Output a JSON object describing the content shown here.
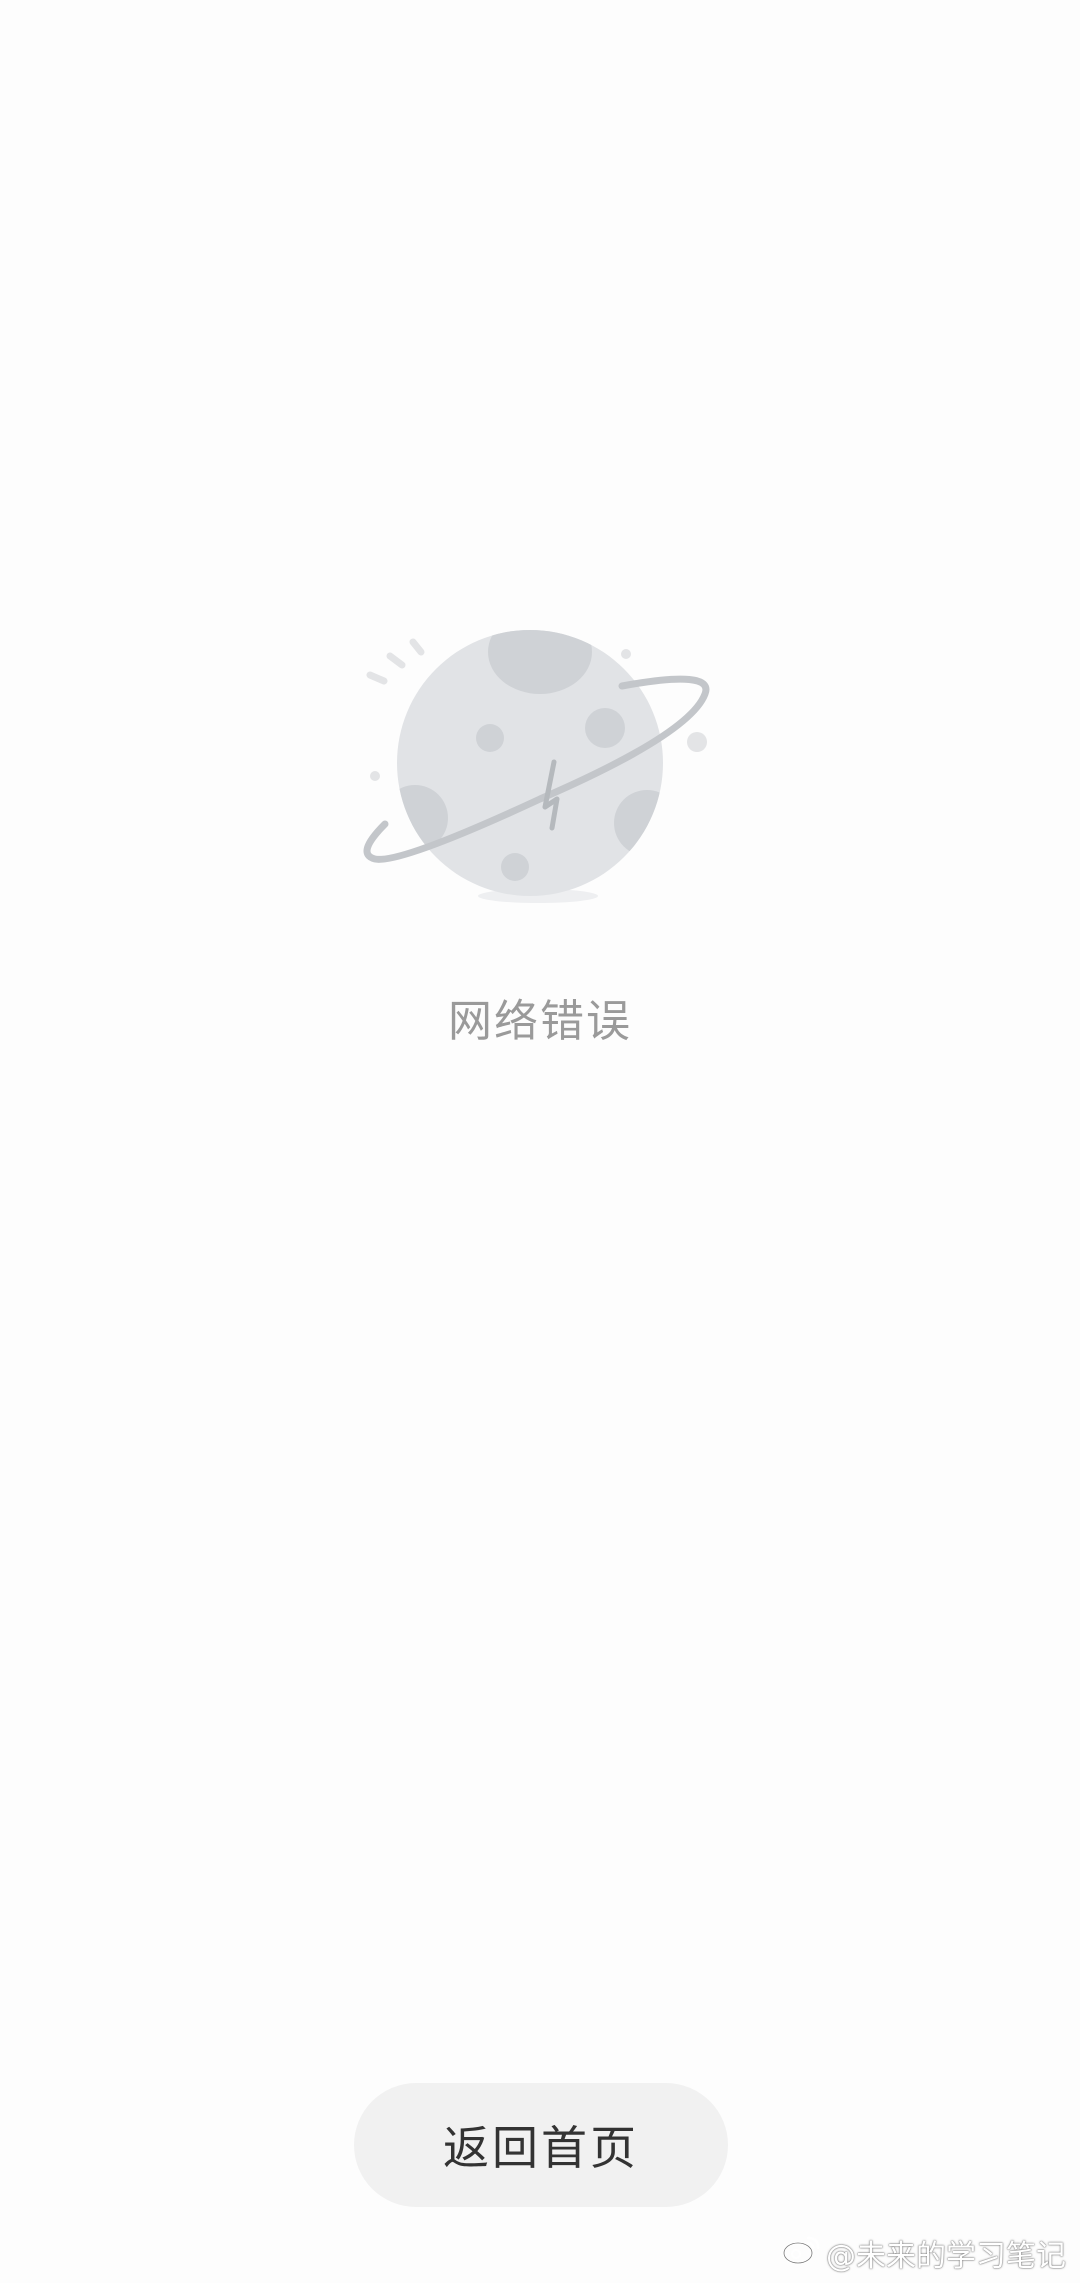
{
  "error": {
    "illustration_icon": "broken-planet-icon",
    "message": "网络错误"
  },
  "actions": {
    "home_button_label": "返回首页"
  },
  "watermark": {
    "icon": "weibo-icon",
    "text": "@未来的学习笔记"
  },
  "colors": {
    "background": "#fdfdfd",
    "planet": "#e1e3e6",
    "crater": "#cfd2d6",
    "orbit": "#c3c6ca",
    "message_text": "#9a9a9a",
    "button_background": "#f1f1f1",
    "button_text": "#333333"
  }
}
